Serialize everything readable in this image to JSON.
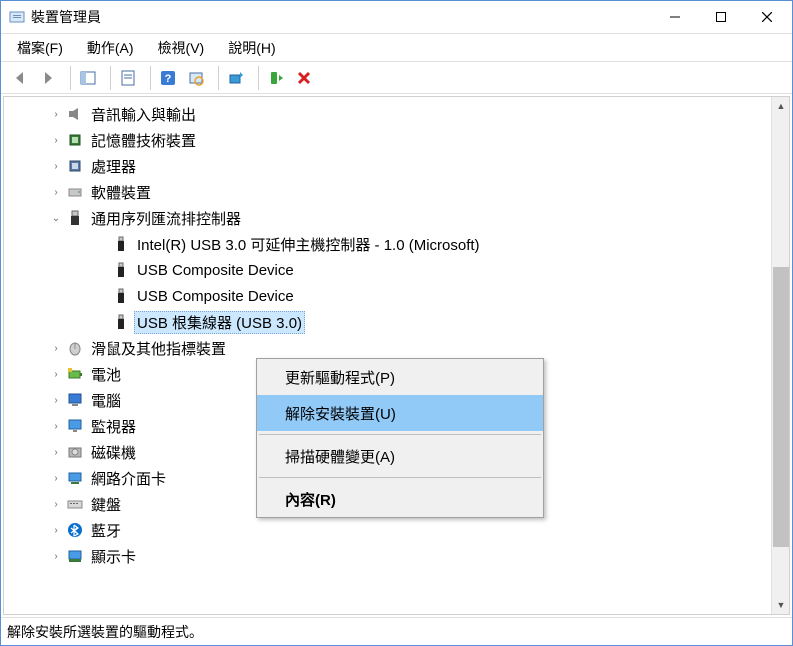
{
  "window": {
    "title": "裝置管理員"
  },
  "menubar": [
    "檔案(F)",
    "動作(A)",
    "檢視(V)",
    "說明(H)"
  ],
  "tree": {
    "items": [
      {
        "label": "音訊輸入與輸出",
        "level": 1,
        "expander": "›",
        "icon": "speaker-icon"
      },
      {
        "label": "記憶體技術裝置",
        "level": 1,
        "expander": "›",
        "icon": "chip-icon"
      },
      {
        "label": "處理器",
        "level": 1,
        "expander": "›",
        "icon": "cpu-icon"
      },
      {
        "label": "軟體裝置",
        "level": 1,
        "expander": "›",
        "icon": "drive-icon"
      },
      {
        "label": "通用序列匯流排控制器",
        "level": 1,
        "expander": "⌄",
        "icon": "usb-controller-icon"
      },
      {
        "label": "Intel(R) USB 3.0 可延伸主機控制器 - 1.0 (Microsoft)",
        "level": 2,
        "expander": "",
        "icon": "usb-icon"
      },
      {
        "label": "USB Composite Device",
        "level": 2,
        "expander": "",
        "icon": "usb-icon"
      },
      {
        "label": "USB Composite Device",
        "level": 2,
        "expander": "",
        "icon": "usb-icon"
      },
      {
        "label": "USB 根集線器 (USB 3.0)",
        "level": 2,
        "expander": "",
        "icon": "usb-icon",
        "selected": true
      },
      {
        "label": "滑鼠及其他指標裝置",
        "level": 1,
        "expander": "›",
        "icon": "mouse-icon"
      },
      {
        "label": "電池",
        "level": 1,
        "expander": "›",
        "icon": "battery-icon"
      },
      {
        "label": "電腦",
        "level": 1,
        "expander": "›",
        "icon": "computer-icon"
      },
      {
        "label": "監視器",
        "level": 1,
        "expander": "›",
        "icon": "monitor-icon"
      },
      {
        "label": "磁碟機",
        "level": 1,
        "expander": "›",
        "icon": "disk-icon"
      },
      {
        "label": "網路介面卡",
        "level": 1,
        "expander": "›",
        "icon": "network-icon"
      },
      {
        "label": "鍵盤",
        "level": 1,
        "expander": "›",
        "icon": "keyboard-icon"
      },
      {
        "label": "藍牙",
        "level": 1,
        "expander": "›",
        "icon": "bluetooth-icon"
      },
      {
        "label": "顯示卡",
        "level": 1,
        "expander": "›",
        "icon": "display-adapter-icon"
      }
    ]
  },
  "context_menu": {
    "items": [
      {
        "label": "更新驅動程式(P)",
        "highlighted": false
      },
      {
        "label": "解除安裝裝置(U)",
        "highlighted": true
      },
      {
        "sep": true
      },
      {
        "label": "掃描硬體變更(A)",
        "highlighted": false
      },
      {
        "sep": true
      },
      {
        "label": "內容(R)",
        "bold": true
      }
    ]
  },
  "statusbar": {
    "text": "解除安裝所選裝置的驅動程式。"
  }
}
